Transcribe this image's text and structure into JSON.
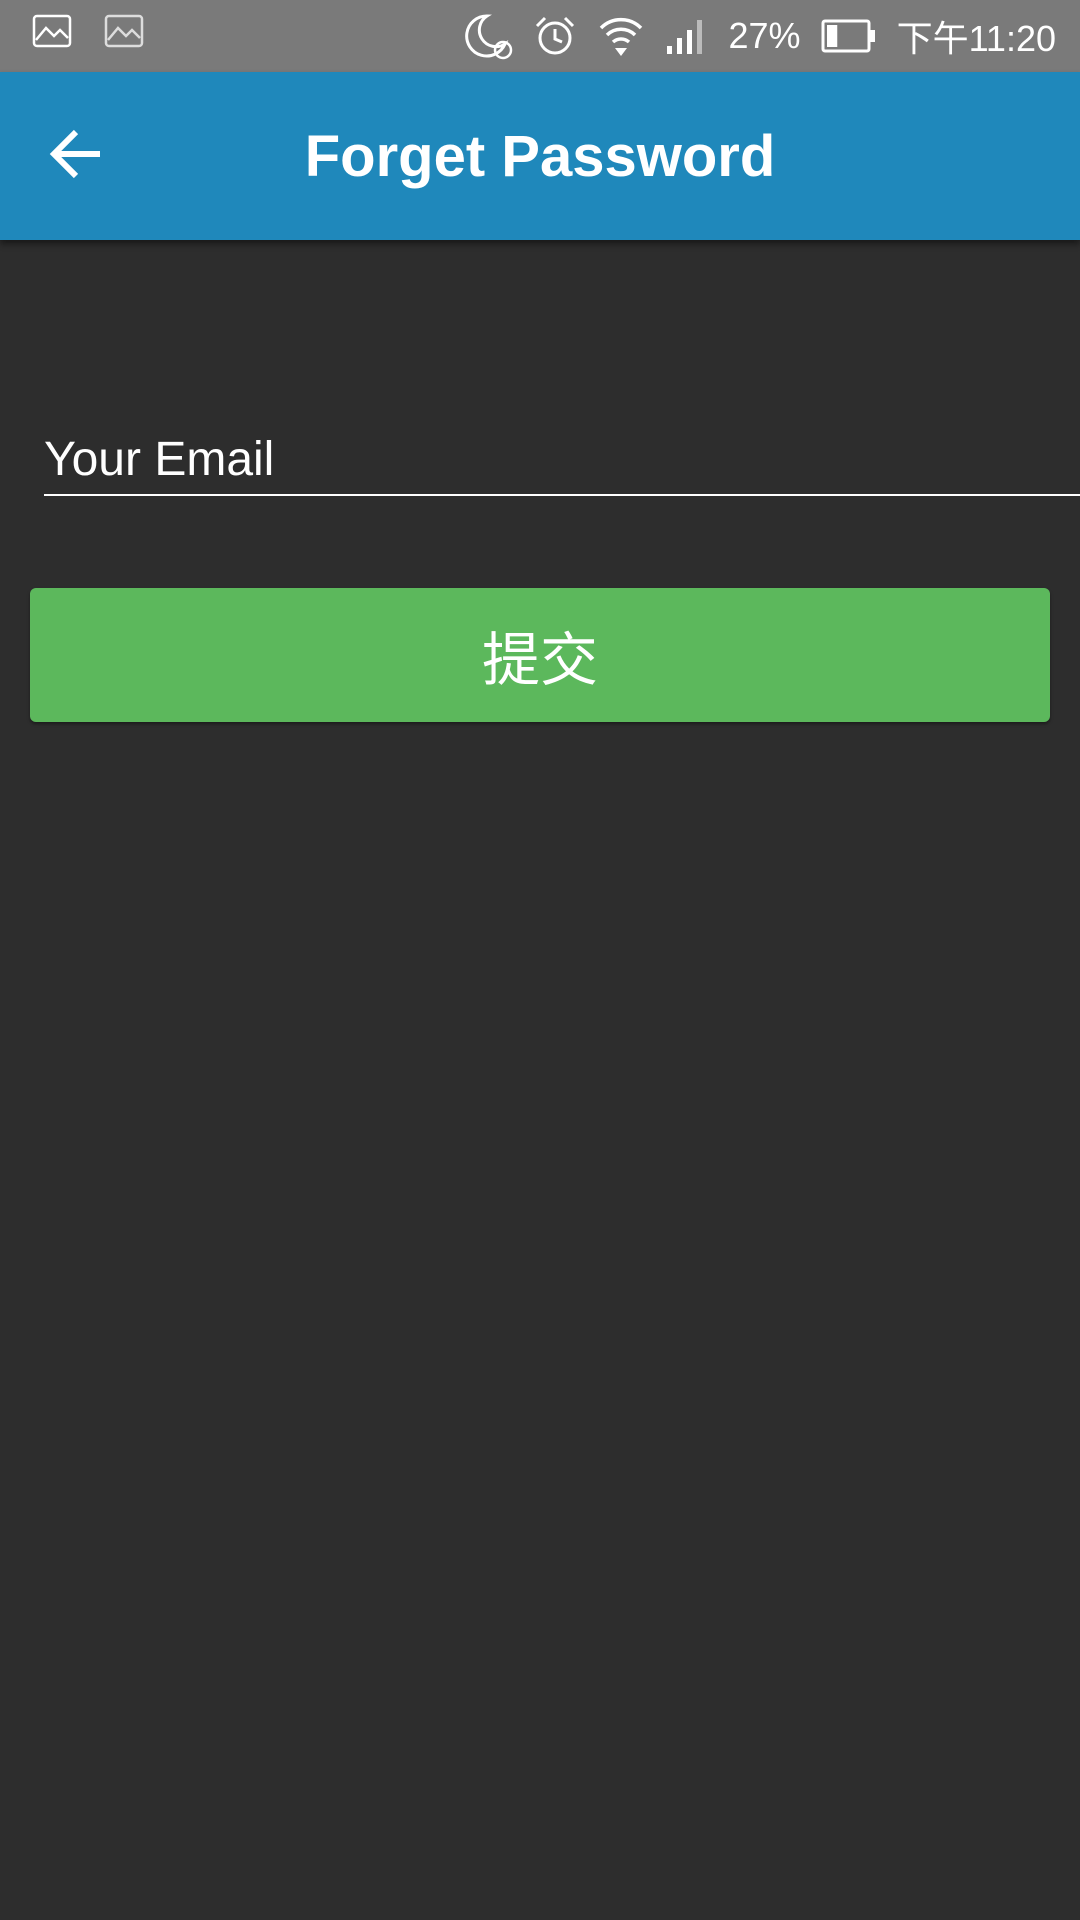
{
  "status_bar": {
    "background": "#7a7a7a",
    "left_icons": [
      "image-icon",
      "image-icon"
    ],
    "right_icons": [
      "night-mode-icon",
      "alarm-clock-icon",
      "wifi-icon",
      "signal-icon"
    ],
    "battery_percent": "27%",
    "battery_level": 0.27,
    "time": "下午11:20"
  },
  "app_bar": {
    "background": "#1f88bb",
    "back_icon": "arrow-back-icon",
    "title": "Forget Password"
  },
  "form": {
    "email_placeholder": "Your Email",
    "email_value": "",
    "submit_label": "提交",
    "submit_color": "#5cb85c"
  }
}
